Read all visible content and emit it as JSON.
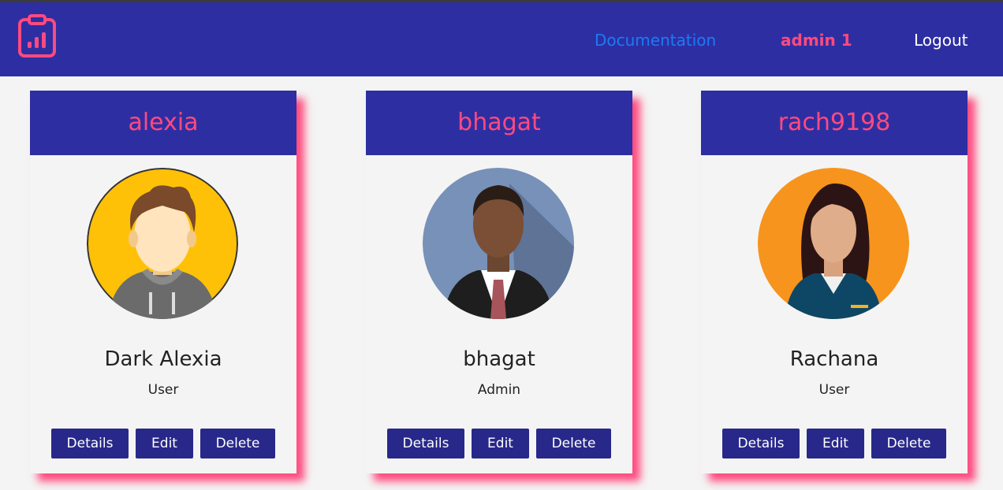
{
  "nav": {
    "logo_icon": "clipboard-chart-icon",
    "documentation_label": "Documentation",
    "user_label": "admin 1",
    "logout_label": "Logout"
  },
  "colors": {
    "navbar": "#2e2ea3",
    "accent": "#ff4a7e",
    "link": "#1a7cf5",
    "button": "#28288a",
    "background": "#f4f4f4"
  },
  "cards": [
    {
      "username": "alexia",
      "name": "Dark Alexia",
      "role": "User",
      "avatar_icon": "boy-hoodie-avatar-icon",
      "buttons": {
        "details": "Details",
        "edit": "Edit",
        "delete": "Delete"
      }
    },
    {
      "username": "bhagat",
      "name": "bhagat",
      "role": "Admin",
      "avatar_icon": "businessman-avatar-icon",
      "buttons": {
        "details": "Details",
        "edit": "Edit",
        "delete": "Delete"
      }
    },
    {
      "username": "rach9198",
      "name": "Rachana",
      "role": "User",
      "avatar_icon": "woman-avatar-icon",
      "buttons": {
        "details": "Details",
        "edit": "Edit",
        "delete": "Delete"
      }
    }
  ]
}
